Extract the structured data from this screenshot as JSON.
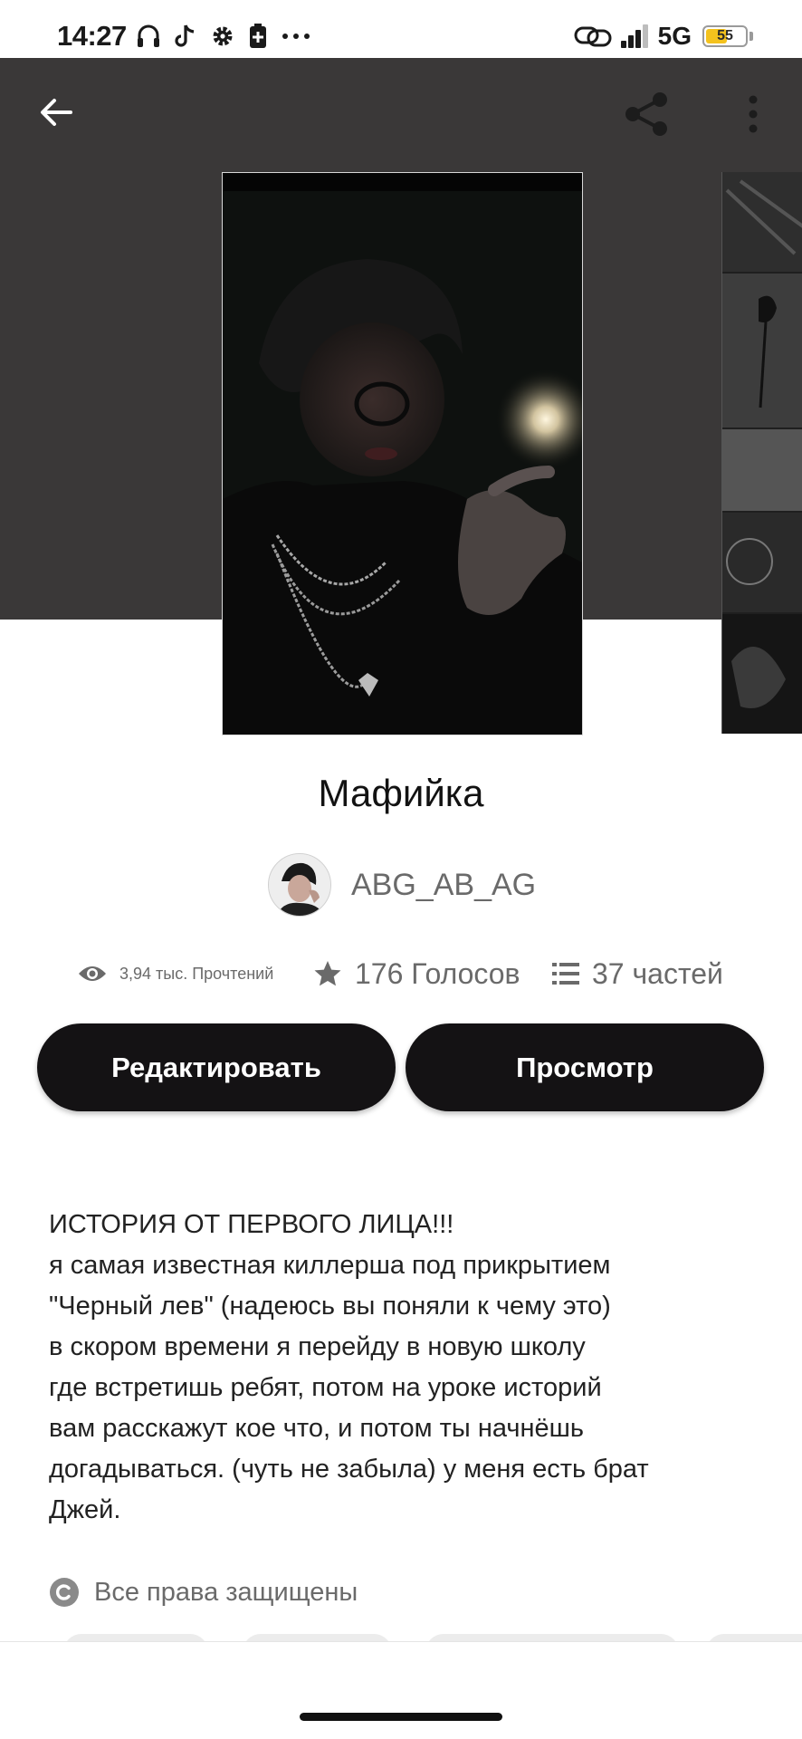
{
  "status_bar": {
    "time": "14:27",
    "network": "5G",
    "battery": "55",
    "battery_level": 0.55,
    "left_icons": [
      "headphones-icon",
      "tiktok-icon",
      "settings-icon",
      "battery-saver-icon",
      "more-dots-icon"
    ],
    "right_icons": [
      "link-icon",
      "signal-icon"
    ]
  },
  "header": {
    "background_color": "#3a3838",
    "back_icon": "arrow-left-icon",
    "share_icon": "share-icon",
    "more_icon": "more-vertical-icon"
  },
  "story": {
    "title": "Мафийка",
    "author": "ABG_AB_AG",
    "stats": {
      "reads": "3,94 тыс. Прочтений",
      "votes": "176 Голосов",
      "parts": "37 частей"
    },
    "buttons": {
      "edit": "Редактировать",
      "view": "Просмотр"
    },
    "description": [
      "ИСТОРИЯ ОТ ПЕРВОГО ЛИЦА!!!",
      "я самая известная киллерша под прикрытием",
      "\"Черный лев\" (надеюсь вы поняли к чему это)",
      "в скором времени я перейду в новую школу",
      "где встретишь ребят, потом на уроке историй",
      "вам расскажут кое что, и потом ты начнёшь",
      "догадываться. (чуть не забыла) у меня есть брат",
      "Джей."
    ],
    "copyright": "Все права защищены"
  },
  "colors": {
    "button_bg": "#141214",
    "button_text": "#ffffff",
    "muted_text": "#6a6a6a",
    "battery_fill": "#f4c21d"
  }
}
